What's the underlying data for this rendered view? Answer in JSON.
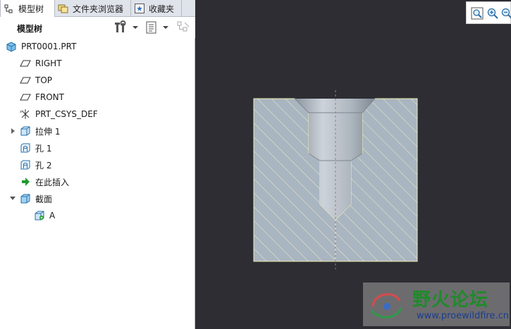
{
  "tabs": [
    {
      "label": "模型树"
    },
    {
      "label": "文件夹浏览器"
    },
    {
      "label": "收藏夹"
    }
  ],
  "toolbar": {
    "title": "模型树"
  },
  "tree": {
    "root": "PRT0001.PRT",
    "items": [
      {
        "label": "RIGHT"
      },
      {
        "label": "TOP"
      },
      {
        "label": "FRONT"
      },
      {
        "label": "PRT_CSYS_DEF"
      },
      {
        "label": "拉伸 1"
      },
      {
        "label": "孔 1"
      },
      {
        "label": "孔 2"
      },
      {
        "label": "在此插入"
      },
      {
        "label": "截面"
      },
      {
        "label": "A"
      }
    ]
  },
  "watermark": {
    "title": "野火论坛",
    "url": "www.proewildfire.cn"
  },
  "colors": {
    "viewport_bg": "#2d2d33",
    "section_fill": "#a9b5c0",
    "hatch": "#e8e6c8",
    "insert_arrow": "#1f9a2f",
    "feature_icon": "#3c8fd0"
  }
}
